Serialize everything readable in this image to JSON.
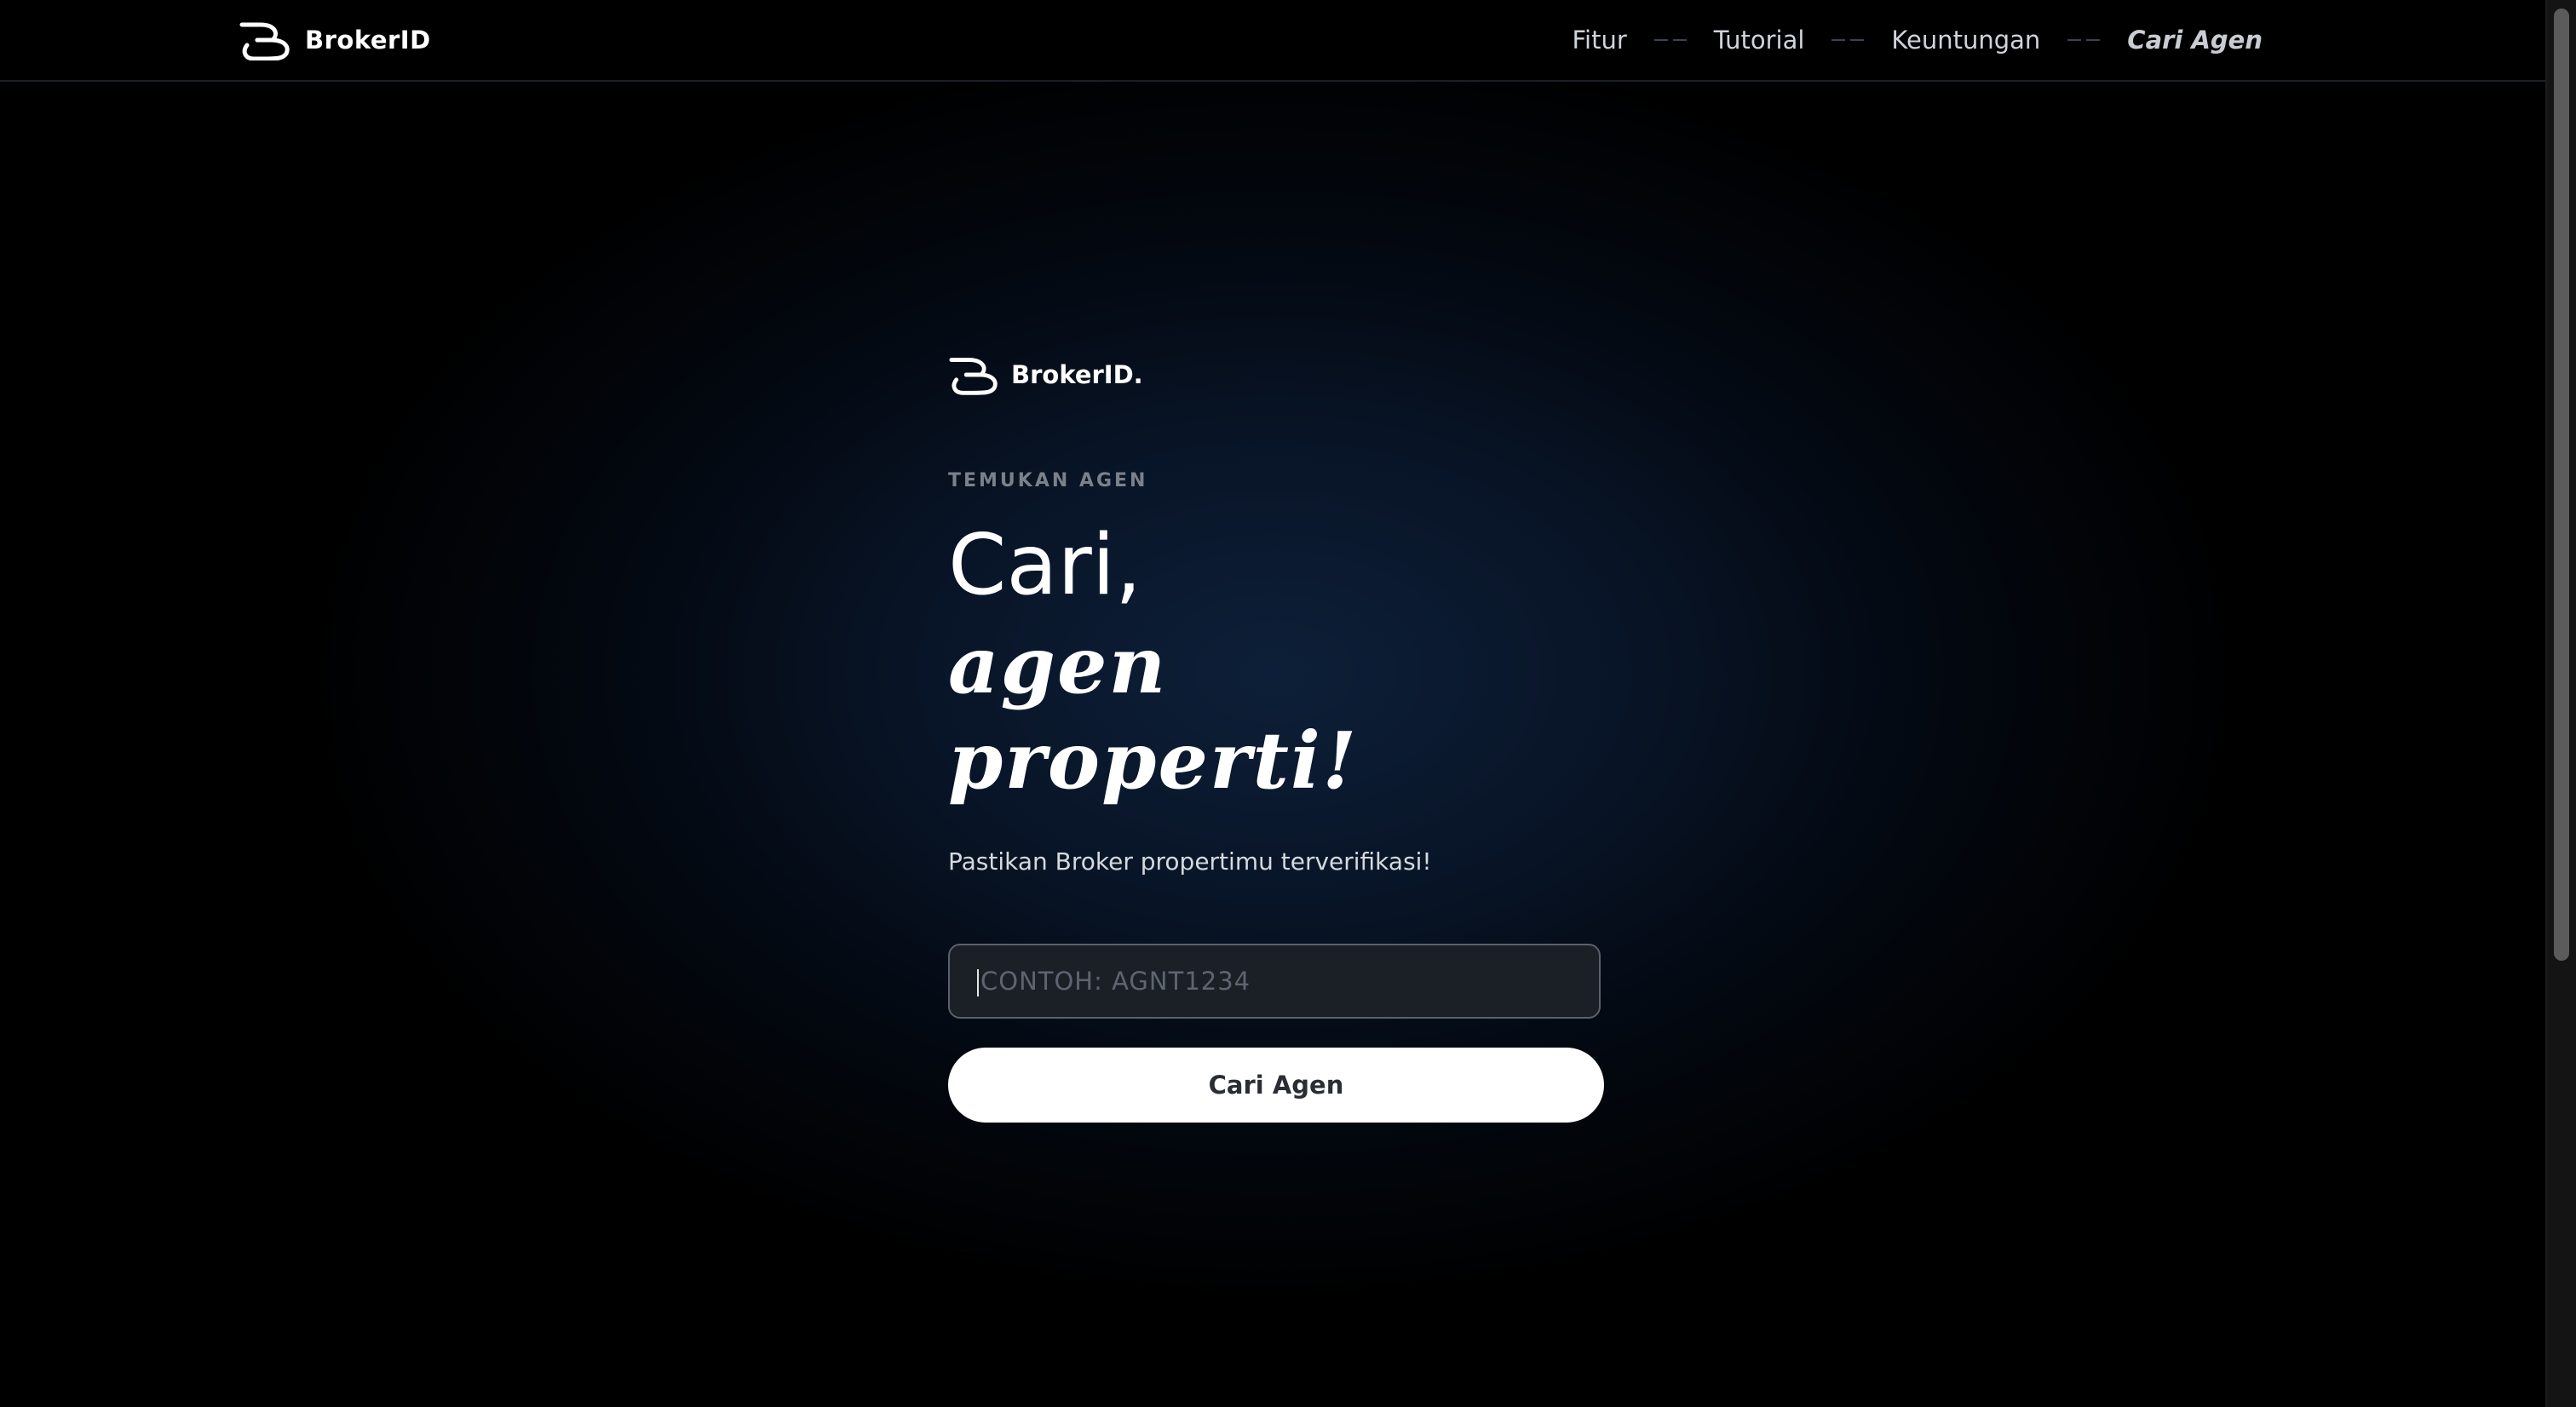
{
  "header": {
    "brand_name": "BrokerID",
    "logo_icon": "brokerid-logo-icon"
  },
  "nav": {
    "items": [
      {
        "label": "Fitur",
        "active": false
      },
      {
        "label": "Tutorial",
        "active": false
      },
      {
        "label": "Keuntungan",
        "active": false
      },
      {
        "label": "Cari Agen",
        "active": true
      }
    ]
  },
  "main": {
    "logo_name": "BrokerID.",
    "eyebrow": "TEMUKAN AGEN",
    "title_line1": "Cari,",
    "title_line2": "agen properti!",
    "subtitle": "Pastikan Broker propertimu terverifikasi!",
    "search": {
      "placeholder": "CONTOH: AGNT1234",
      "value": ""
    },
    "button_label": "Cari Agen"
  },
  "colors": {
    "background": "#000000",
    "glow": "#0d1f38",
    "button_bg": "#ffffff",
    "button_text": "#2a2d33",
    "eyebrow": "#7b808a"
  }
}
